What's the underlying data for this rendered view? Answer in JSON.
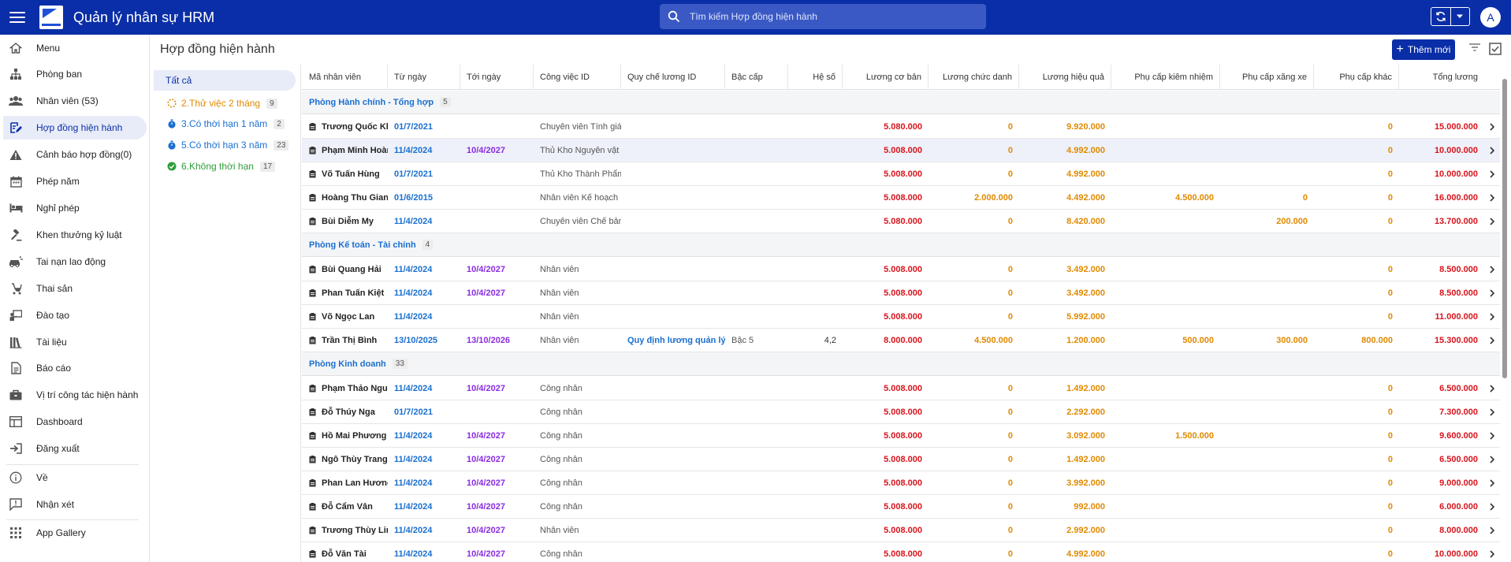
{
  "app": {
    "title": "Quản lý nhân sự HRM",
    "avatar_letter": "A"
  },
  "search": {
    "placeholder": "Tìm kiếm Hợp đồng hiện hành"
  },
  "sidebar": {
    "items": [
      {
        "label": "Menu",
        "icon": "home-icon"
      },
      {
        "label": "Phòng ban",
        "icon": "org-chart-icon"
      },
      {
        "label": "Nhân viên (53)",
        "icon": "people-icon"
      },
      {
        "label": "Hợp đồng hiện hành",
        "icon": "contract-edit-icon",
        "active": true
      },
      {
        "label": "Cảnh báo hợp đồng(0)",
        "icon": "warning-icon"
      },
      {
        "label": "Phép năm",
        "icon": "calendar-icon"
      },
      {
        "label": "Nghỉ phép",
        "icon": "bed-icon"
      },
      {
        "label": "Khen thưởng kỷ luật",
        "icon": "gavel-icon"
      },
      {
        "label": "Tai nạn lao động",
        "icon": "car-crash-icon"
      },
      {
        "label": "Thai sản",
        "icon": "stroller-icon"
      },
      {
        "label": "Đào tạo",
        "icon": "training-icon"
      },
      {
        "label": "Tài liệu",
        "icon": "library-icon"
      },
      {
        "label": "Báo cáo",
        "icon": "report-icon"
      },
      {
        "label": "Vị trí công tác hiện hành",
        "icon": "briefcase-icon"
      },
      {
        "label": "Dashboard",
        "icon": "dashboard-icon"
      },
      {
        "label": "Đăng xuất",
        "icon": "logout-icon"
      },
      {
        "label": "Về",
        "icon": "info-icon"
      },
      {
        "label": "Nhận xét",
        "icon": "feedback-icon"
      },
      {
        "label": "App Gallery",
        "icon": "apps-grid-icon"
      }
    ]
  },
  "page": {
    "title": "Hợp đồng hiện hành",
    "add_label": "Thêm mới"
  },
  "filters": {
    "all_label": "Tất cả",
    "items": [
      {
        "label": "2.Thử việc 2 tháng",
        "count": "9",
        "color": "#e08a00"
      },
      {
        "label": "3.Có thời hạn 1 năm",
        "count": "2",
        "color": "#1a6fd0"
      },
      {
        "label": "5.Có thời hạn 3 năm",
        "count": "23",
        "color": "#1a6fd0"
      },
      {
        "label": "6.Không thời hạn",
        "count": "17",
        "color": "#2e9e3a"
      }
    ]
  },
  "table": {
    "columns": [
      "Mã nhân viên",
      "Từ ngày",
      "Tới ngày",
      "Công việc ID",
      "Quy chế lương ID",
      "Bậc cấp",
      "Hệ số",
      "Lương cơ bản",
      "Lương chức danh",
      "Lương hiệu quả",
      "Phụ cấp kiêm nhiệm",
      "Phụ cấp xăng xe",
      "Phụ cấp khác",
      "Tổng lương"
    ],
    "groups": [
      {
        "name": "Phòng Hành chính - Tổng hợp",
        "count": "5",
        "rows": [
          {
            "name": "Trương Quốc Khá",
            "from": "01/7/2021",
            "to": "",
            "job": "Chuyên viên Tính giá",
            "rule": "",
            "level": "",
            "coef": "",
            "base": "5.080.000",
            "title": "0",
            "perf": "9.920.000",
            "concur": "",
            "fuel": "",
            "other": "0",
            "total": "15.000.000"
          },
          {
            "name": "Phạm Minh Hoàn",
            "from": "11/4/2024",
            "to": "10/4/2027",
            "job": "Thủ Kho Nguyên vật li",
            "rule": "",
            "level": "",
            "coef": "",
            "base": "5.008.000",
            "title": "0",
            "perf": "4.992.000",
            "concur": "",
            "fuel": "",
            "other": "0",
            "total": "10.000.000",
            "highlight": true
          },
          {
            "name": "Võ Tuấn Hùng",
            "from": "01/7/2021",
            "to": "",
            "job": "Thủ Kho Thành Phẩm",
            "rule": "",
            "level": "",
            "coef": "",
            "base": "5.008.000",
            "title": "0",
            "perf": "4.992.000",
            "concur": "",
            "fuel": "",
            "other": "0",
            "total": "10.000.000"
          },
          {
            "name": "Hoàng Thu Giang",
            "from": "01/6/2015",
            "to": "",
            "job": "Nhân viên Kế hoạch",
            "rule": "",
            "level": "",
            "coef": "",
            "base": "5.008.000",
            "title": "2.000.000",
            "perf": "4.492.000",
            "concur": "4.500.000",
            "fuel": "0",
            "other": "0",
            "total": "16.000.000"
          },
          {
            "name": "Bùi Diễm My",
            "from": "11/4/2024",
            "to": "",
            "job": "Chuyên viên Chế bản l",
            "rule": "",
            "level": "",
            "coef": "",
            "base": "5.080.000",
            "title": "0",
            "perf": "8.420.000",
            "concur": "",
            "fuel": "200.000",
            "other": "0",
            "total": "13.700.000"
          }
        ]
      },
      {
        "name": "Phòng Kế toán - Tài chính",
        "count": "4",
        "rows": [
          {
            "name": "Bùi Quang Hải",
            "from": "11/4/2024",
            "to": "10/4/2027",
            "job": "Nhân viên",
            "rule": "",
            "level": "",
            "coef": "",
            "base": "5.008.000",
            "title": "0",
            "perf": "3.492.000",
            "concur": "",
            "fuel": "",
            "other": "0",
            "total": "8.500.000"
          },
          {
            "name": "Phan Tuấn Kiệt",
            "from": "11/4/2024",
            "to": "10/4/2027",
            "job": "Nhân viên",
            "rule": "",
            "level": "",
            "coef": "",
            "base": "5.008.000",
            "title": "0",
            "perf": "3.492.000",
            "concur": "",
            "fuel": "",
            "other": "0",
            "total": "8.500.000"
          },
          {
            "name": "Võ Ngọc Lan",
            "from": "11/4/2024",
            "to": "",
            "job": "Nhân viên",
            "rule": "",
            "level": "",
            "coef": "",
            "base": "5.008.000",
            "title": "0",
            "perf": "5.992.000",
            "concur": "",
            "fuel": "",
            "other": "0",
            "total": "11.000.000"
          },
          {
            "name": "Trần Thị Bình",
            "from": "13/10/2025",
            "to": "13/10/2026",
            "job": "Nhân viên",
            "rule": "Quy định lương quản lý cấp",
            "level": "Bậc 5",
            "coef": "4,2",
            "base": "8.000.000",
            "title": "4.500.000",
            "perf": "1.200.000",
            "concur": "500.000",
            "fuel": "300.000",
            "other": "800.000",
            "total": "15.300.000"
          }
        ]
      },
      {
        "name": "Phòng Kinh doanh",
        "count": "33",
        "rows": [
          {
            "name": "Phạm Thảo Nguyên",
            "from": "11/4/2024",
            "to": "10/4/2027",
            "job": "Công nhân",
            "rule": "",
            "level": "",
            "coef": "",
            "base": "5.008.000",
            "title": "0",
            "perf": "1.492.000",
            "concur": "",
            "fuel": "",
            "other": "0",
            "total": "6.500.000"
          },
          {
            "name": "Đỗ Thúy Nga",
            "from": "01/7/2021",
            "to": "",
            "job": "Công nhân",
            "rule": "",
            "level": "",
            "coef": "",
            "base": "5.008.000",
            "title": "0",
            "perf": "2.292.000",
            "concur": "",
            "fuel": "",
            "other": "0",
            "total": "7.300.000"
          },
          {
            "name": "Hồ Mai Phương",
            "from": "11/4/2024",
            "to": "10/4/2027",
            "job": "Công nhân",
            "rule": "",
            "level": "",
            "coef": "",
            "base": "5.008.000",
            "title": "0",
            "perf": "3.092.000",
            "concur": "1.500.000",
            "fuel": "",
            "other": "0",
            "total": "9.600.000"
          },
          {
            "name": "Ngô Thùy Trang",
            "from": "11/4/2024",
            "to": "10/4/2027",
            "job": "Công nhân",
            "rule": "",
            "level": "",
            "coef": "",
            "base": "5.008.000",
            "title": "0",
            "perf": "1.492.000",
            "concur": "",
            "fuel": "",
            "other": "0",
            "total": "6.500.000"
          },
          {
            "name": "Phan Lan Hương",
            "from": "11/4/2024",
            "to": "10/4/2027",
            "job": "Công nhân",
            "rule": "",
            "level": "",
            "coef": "",
            "base": "5.008.000",
            "title": "0",
            "perf": "3.992.000",
            "concur": "",
            "fuel": "",
            "other": "0",
            "total": "9.000.000"
          },
          {
            "name": "Đỗ Cẩm Vân",
            "from": "11/4/2024",
            "to": "10/4/2027",
            "job": "Công nhân",
            "rule": "",
            "level": "",
            "coef": "",
            "base": "5.008.000",
            "title": "0",
            "perf": "992.000",
            "concur": "",
            "fuel": "",
            "other": "0",
            "total": "6.000.000"
          },
          {
            "name": "Trương Thùy Linh",
            "from": "11/4/2024",
            "to": "10/4/2027",
            "job": "Nhân viên",
            "rule": "",
            "level": "",
            "coef": "",
            "base": "5.008.000",
            "title": "0",
            "perf": "2.992.000",
            "concur": "",
            "fuel": "",
            "other": "0",
            "total": "8.000.000"
          },
          {
            "name": "Đỗ Văn Tài",
            "from": "11/4/2024",
            "to": "10/4/2027",
            "job": "Công nhân",
            "rule": "",
            "level": "",
            "coef": "",
            "base": "5.008.000",
            "title": "0",
            "perf": "4.992.000",
            "concur": "",
            "fuel": "",
            "other": "0",
            "total": "10.000.000"
          }
        ]
      }
    ]
  },
  "colors": {
    "primary": "#0a2ea7",
    "link": "#1a6fd0",
    "end_date": "#8a2be2",
    "money_red": "#d8141c",
    "money_orange": "#e08a00"
  }
}
